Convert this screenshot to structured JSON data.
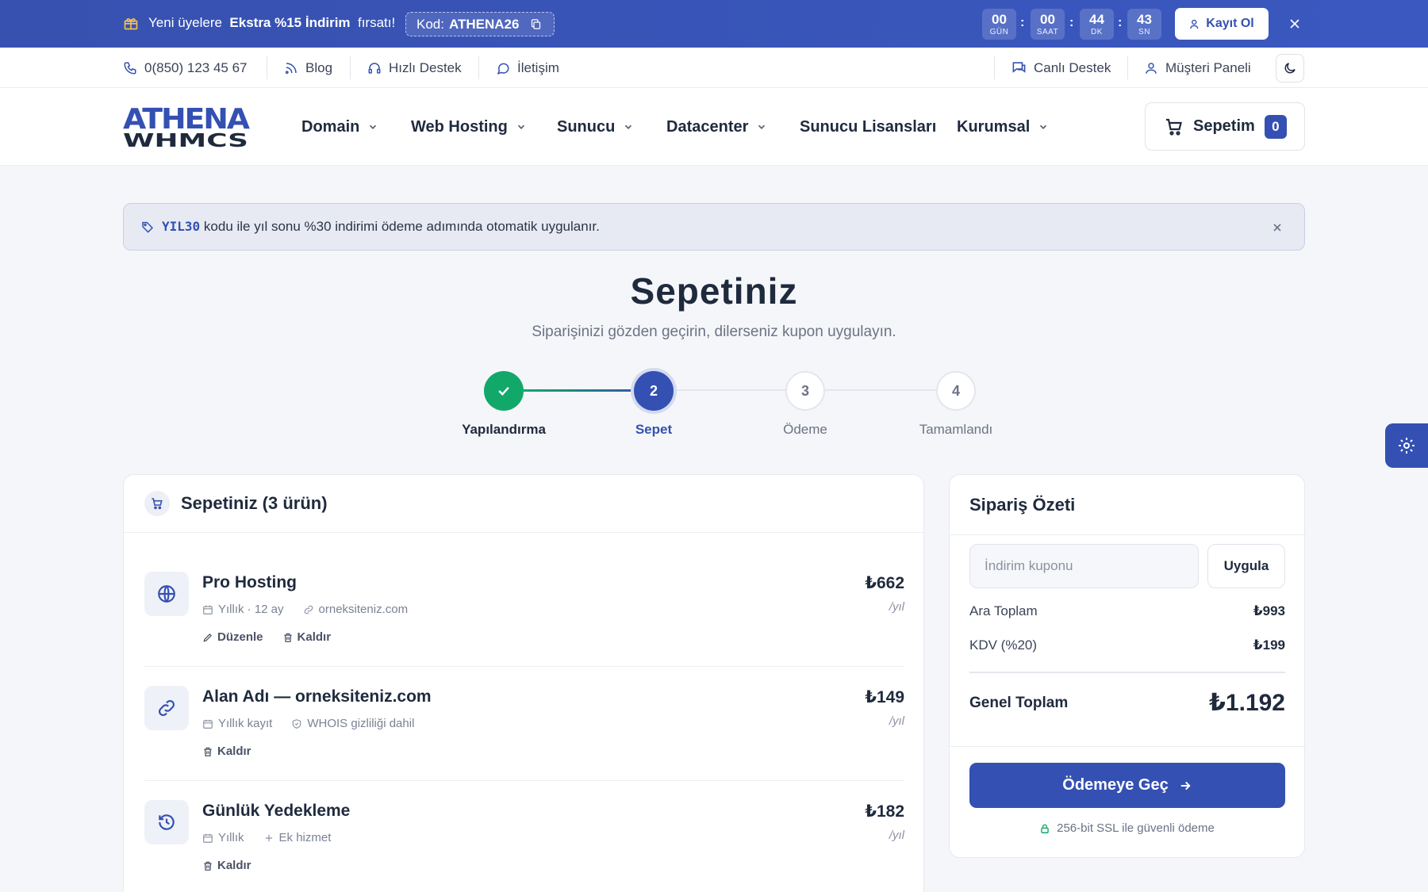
{
  "promo": {
    "text_before": "Yeni üyelere",
    "highlight": "Ekstra %15 İndirim",
    "text_after": "fırsatı!",
    "code_label": "Kod:",
    "code": "ATHENA26",
    "countdown": [
      {
        "value": "00",
        "unit": "GÜN"
      },
      {
        "value": "00",
        "unit": "SAAT"
      },
      {
        "value": "44",
        "unit": "DK"
      },
      {
        "value": "43",
        "unit": "SN"
      }
    ],
    "countdown_sep": ":",
    "register_label": "Kayıt Ol"
  },
  "util": {
    "phone": "0(850) 123 45 67",
    "blog": "Blog",
    "support": "Hızlı Destek",
    "contact": "İletişim",
    "live": "Canlı Destek",
    "panel": "Müşteri Paneli"
  },
  "nav": {
    "logo_top": "ATHENA",
    "logo_bottom": "WHMCS",
    "items": [
      "Domain",
      "Web Hosting",
      "Sunucu",
      "Datacenter",
      "Sunucu Lisansları",
      "Kurumsal"
    ],
    "cart_label": "Sepetim",
    "cart_count": "0"
  },
  "notice": {
    "code": "YIL30",
    "text": "kodu ile yıl sonu %30 indirimi ödeme adımında otomatik uygulanır."
  },
  "page": {
    "title": "Sepetiniz",
    "subtitle": "Siparişinizi gözden geçirin, dilerseniz kupon uygulayın."
  },
  "steps": [
    {
      "num": "1",
      "label": "Yapılandırma",
      "state": "done"
    },
    {
      "num": "2",
      "label": "Sepet",
      "state": "active"
    },
    {
      "num": "3",
      "label": "Ödeme",
      "state": "todo"
    },
    {
      "num": "4",
      "label": "Tamamlandı",
      "state": "todo"
    }
  ],
  "cart": {
    "title": "Sepetiniz (3 ürün)",
    "items": [
      {
        "name": "Pro Hosting",
        "meta1": "Yıllık · 12 ay",
        "meta2": "orneksiteniz.com",
        "edit": "Düzenle",
        "remove": "Kaldır",
        "price": "₺662",
        "per": "/yıl"
      },
      {
        "name": "Alan Adı — orneksiteniz.com",
        "meta1": "Yıllık kayıt",
        "meta2": "WHOIS gizliliği dahil",
        "remove": "Kaldır",
        "price": "₺149",
        "per": "/yıl"
      },
      {
        "name": "Günlük Yedekleme",
        "meta1": "Yıllık",
        "meta2": "Ek hizmet",
        "remove": "Kaldır",
        "price": "₺182",
        "per": "/yıl"
      }
    ]
  },
  "summary": {
    "title": "Sipariş Özeti",
    "coupon_placeholder": "İndirim kuponu",
    "apply": "Uygula",
    "subtotal_label": "Ara Toplam",
    "subtotal": "₺993",
    "vat_label": "KDV (%20)",
    "vat": "₺199",
    "total_label": "Genel Toplam",
    "total": "₺1.192",
    "pay": "Ödemeye Geç",
    "secure": "256-bit SSL ile güvenli ödeme"
  },
  "colors": {
    "primary": "#3450b2",
    "success": "#12a86a"
  }
}
